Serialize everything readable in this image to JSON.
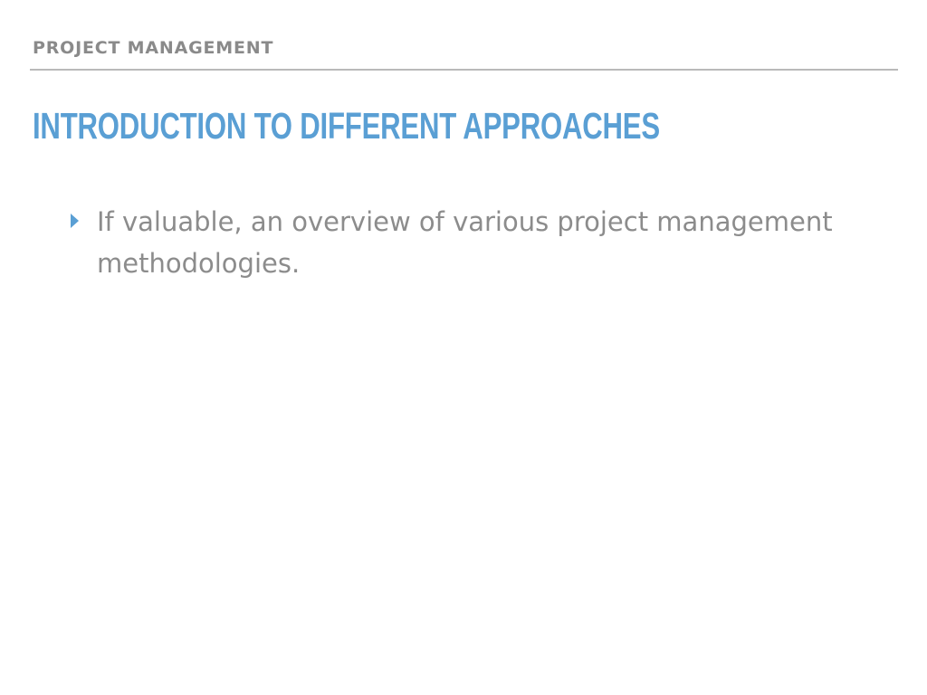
{
  "slide": {
    "section_header": "PROJECT MANAGEMENT",
    "title": "INTRODUCTION TO DIFFERENT APPROACHES",
    "bullets": [
      {
        "icon": "triangle-bullet-icon",
        "text": "If valuable, an overview of various project management methodologies."
      }
    ]
  },
  "colors": {
    "accent": "#5a9fd4",
    "header_text": "#8a8a8a",
    "body_text": "#8c8c8c",
    "rule": "#b9b9b9",
    "background": "#ffffff"
  }
}
